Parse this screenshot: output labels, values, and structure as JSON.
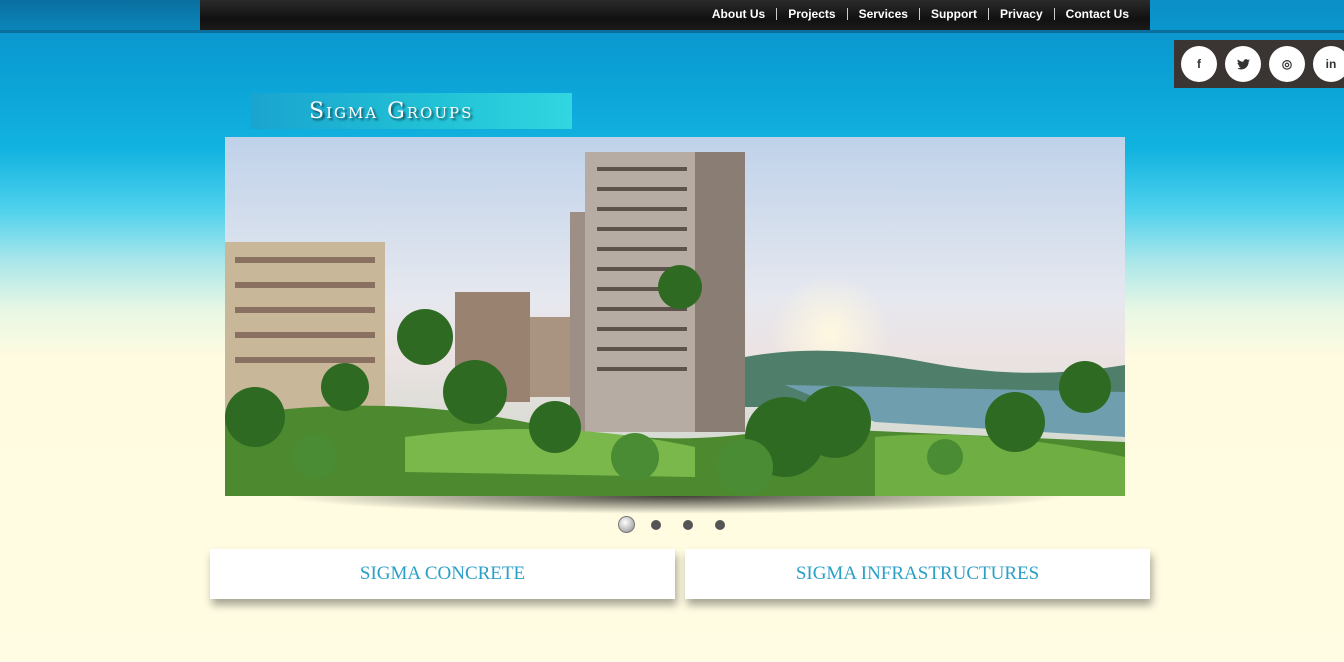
{
  "nav": {
    "items": [
      "About Us",
      "Projects",
      "Services",
      "Support",
      "Privacy",
      "Contact Us"
    ]
  },
  "social": {
    "facebook": "f",
    "twitter": "t",
    "dribbble": "◎",
    "linkedin": "in"
  },
  "logo": {
    "text": "Sigma Groups"
  },
  "slider": {
    "slide_count": 4,
    "active_index": 0
  },
  "cards": [
    {
      "label": "SIGMA CONCRETE"
    },
    {
      "label": "SIGMA INFRASTRUCTURES"
    }
  ],
  "colors": {
    "accent": "#2aa0c8",
    "topbar": "#1a1a1a",
    "social_bg": "#3a3532"
  }
}
